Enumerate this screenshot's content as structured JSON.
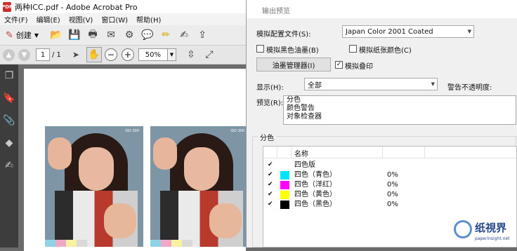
{
  "app": {
    "window_title": "两种ICC.pdf - Adobe Acrobat Pro",
    "menu": [
      "文件(F)",
      "编辑(E)",
      "视图(V)",
      "窗口(W)",
      "帮助(H)"
    ],
    "create_label": "创建",
    "page_current": "1",
    "page_total": "/ 1",
    "zoom_value": "50%"
  },
  "page": {
    "photo_label_1": "ISO 300",
    "photo_label_2": "ISO 300",
    "strip_colors": [
      "#8fd3e8",
      "#f2a7c8",
      "#f7f1a0",
      "#d9d9d9"
    ]
  },
  "dialog": {
    "title": "输出预览",
    "profile_label": "模拟配置文件(S):",
    "profile_value": "Japan Color 2001 Coated",
    "simulate_black_ink": "模拟黑色油墨(B)",
    "simulate_paper_color": "模拟纸张颜色(C)",
    "ink_manager_button": "油墨管理器(I)",
    "simulate_overprint": "模拟叠印",
    "show_label": "显示(H):",
    "show_value": "全部",
    "warning_opacity_label": "警告不透明度:",
    "preview_label": "预览(R):",
    "preview_options": [
      "分色",
      "颜色警告",
      "对象检查器"
    ],
    "separations_group": "分色",
    "sep_header_name": "名称",
    "separations": [
      {
        "name": "四色版",
        "percent": "",
        "swatch": ""
      },
      {
        "name": "四色（青色）",
        "percent": "0%",
        "swatch": "#00e5ff"
      },
      {
        "name": "四色（洋红）",
        "percent": "0%",
        "swatch": "#ff00ff"
      },
      {
        "name": "四色（黄色）",
        "percent": "0%",
        "swatch": "#ffff00"
      },
      {
        "name": "四色（黑色）",
        "percent": "0%",
        "swatch": "#000000"
      }
    ]
  },
  "watermark": {
    "brand": "纸視界",
    "url": "paperinsight.net"
  },
  "colors": {
    "accent_blue": "#5b8fd0",
    "pdf_red": "#d12b2b"
  }
}
